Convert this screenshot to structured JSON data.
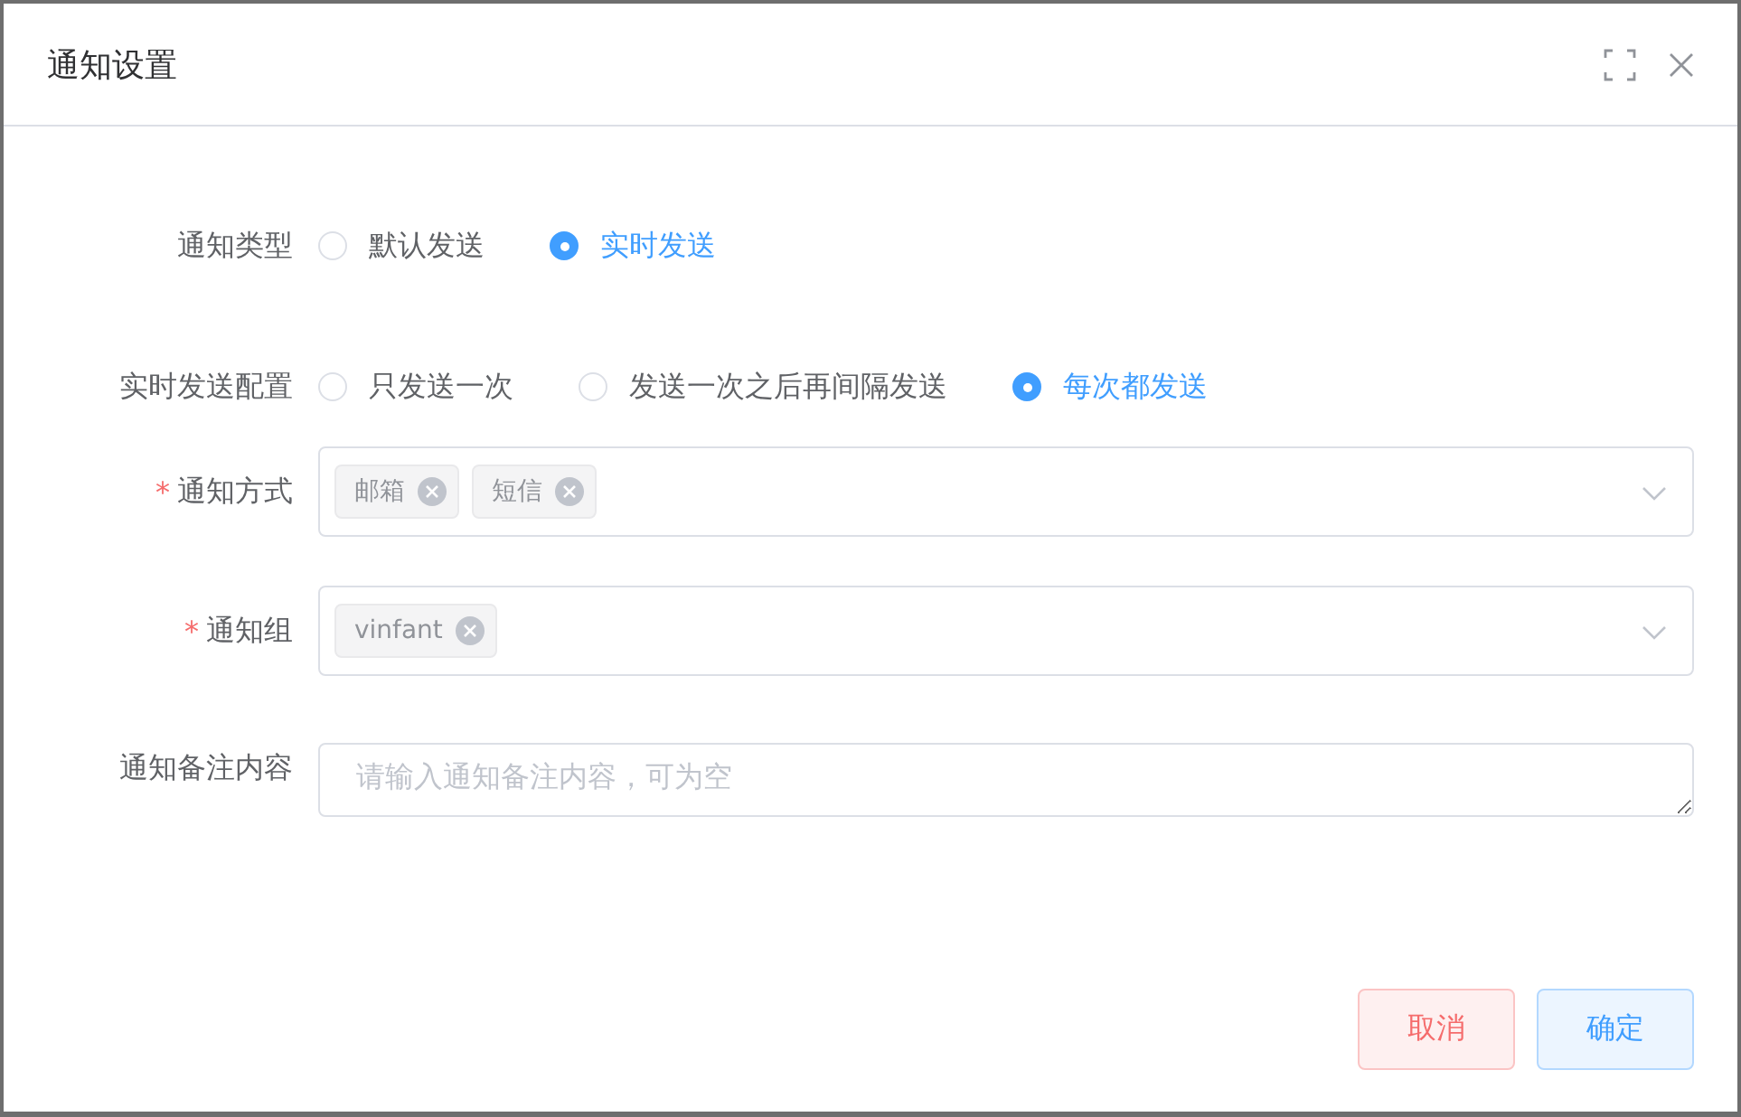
{
  "dialog": {
    "title": "通知设置"
  },
  "form": {
    "notify_type": {
      "label": "通知类型",
      "options": [
        {
          "label": "默认发送",
          "selected": false
        },
        {
          "label": "实时发送",
          "selected": true
        }
      ]
    },
    "realtime_config": {
      "label": "实时发送配置",
      "options": [
        {
          "label": "只发送一次",
          "selected": false
        },
        {
          "label": "发送一次之后再间隔发送",
          "selected": false
        },
        {
          "label": "每次都发送",
          "selected": true
        }
      ]
    },
    "notify_method": {
      "label": "通知方式",
      "required_mark": "*",
      "tags": [
        "邮箱",
        "短信"
      ]
    },
    "notify_group": {
      "label": "通知组",
      "required_mark": "*",
      "tags": [
        "vinfant"
      ]
    },
    "remark": {
      "label": "通知备注内容",
      "placeholder": "请输入通知备注内容，可为空"
    }
  },
  "buttons": [
    {
      "label": "取消",
      "kind": "cancel"
    },
    {
      "label": "确定",
      "kind": "confirm"
    }
  ]
}
